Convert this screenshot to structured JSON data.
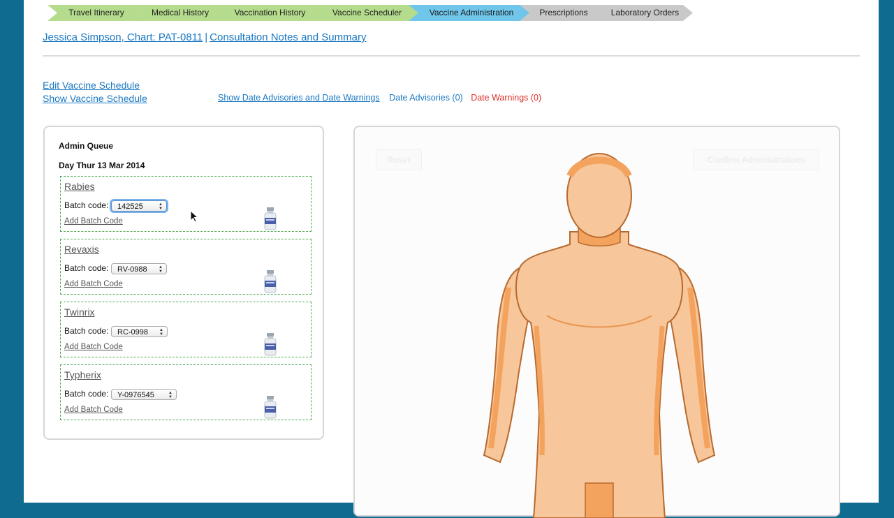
{
  "workflow_steps": [
    {
      "label": "Travel Itinerary",
      "state": "done"
    },
    {
      "label": "Medical History",
      "state": "done"
    },
    {
      "label": "Vaccination History",
      "state": "done"
    },
    {
      "label": "Vaccine Scheduler",
      "state": "done"
    },
    {
      "label": "Vaccine Administration",
      "state": "active"
    },
    {
      "label": "Prescriptions",
      "state": "todo"
    },
    {
      "label": "Laboratory Orders",
      "state": "todo"
    }
  ],
  "header": {
    "patient_link": "Jessica Simpson, Chart: PAT-0811",
    "separator": "|",
    "notes_link": "Consultation Notes and Summary"
  },
  "links": {
    "edit_schedule": "Edit Vaccine Schedule",
    "show_schedule": "Show Vaccine Schedule",
    "show_advisories": "Show Date Advisories and Date Warnings",
    "date_advisories": "Date Advisories (0)",
    "date_warnings": "Date Warnings (0)"
  },
  "queue": {
    "title": "Admin Queue",
    "day": "Day Thur 13 Mar 2014",
    "batch_label": "Batch code:",
    "add_batch_label": "Add Batch Code",
    "items": [
      {
        "name": "Rabies",
        "batch": "142525"
      },
      {
        "name": "Revaxis",
        "batch": "RV-0988"
      },
      {
        "name": "Twinrix",
        "batch": "RC-0998"
      },
      {
        "name": "Typherix",
        "batch": "Y-0976545"
      }
    ]
  },
  "body_panel": {
    "reset_label": "Reset",
    "confirm_label": "Confirm Administrations"
  },
  "colors": {
    "done": "#b5dc8c",
    "active": "#6fc6ea",
    "todo": "#c9c9c9",
    "link": "#1a78c2",
    "warning": "#e0302a",
    "skin": "#f7c69a",
    "skin_shade": "#f3a35e"
  }
}
